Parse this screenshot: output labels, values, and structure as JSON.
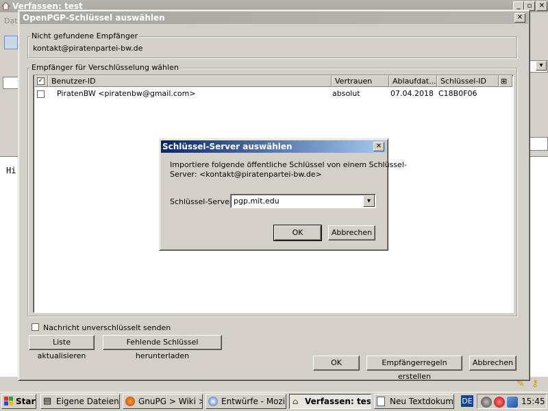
{
  "background_window": {
    "title": "Verfassen: test",
    "menu_partial": "Date",
    "editor_text": "Hi"
  },
  "openpgp_dialog": {
    "title": "OpenPGP-Schlüssel auswählen",
    "not_found_group": {
      "label": "Nicht gefundene Empfänger",
      "email": "kontakt@piratenpartei-bw.de"
    },
    "recipients_group": {
      "label": "Empfänger für Verschlüsselung wählen",
      "columns": [
        "Benutzer-ID",
        "Vertrauen",
        "Ablaufdat...",
        "Schlüssel-ID"
      ],
      "rows": [
        {
          "user_id": "PiratenBW <piratenbw@gmail.com>",
          "trust": "absolut",
          "expiry": "07.04.2018",
          "key_id": "C18B0F06",
          "checked": false
        }
      ]
    },
    "send_unencrypted_label": "Nachricht unverschlüsselt senden",
    "refresh_button": "Liste aktualisieren",
    "download_missing_button": "Fehlende Schlüssel herunterladen",
    "ok_button": "OK",
    "create_rules_button": "Empfängerregeln erstellen",
    "cancel_button": "Abbrechen"
  },
  "keyserver_dialog": {
    "title": "Schlüssel-Server auswählen",
    "message_line1": "Importiere folgende öffentliche Schlüssel von einem Schlüssel-",
    "message_line2": "Server: <kontakt@piratenpartei-bw.de>",
    "server_label": "Schlüssel-Server",
    "server_value": "pgp.mit.edu",
    "ok_button": "OK",
    "cancel_button": "Abbrechen"
  },
  "taskbar": {
    "start_label": "Start",
    "items": [
      {
        "label": "Eigene Dateien",
        "active": false
      },
      {
        "label": "GnuPG > Wiki > u...",
        "active": false
      },
      {
        "label": "Entwürfe - Mozill...",
        "active": false
      },
      {
        "label": "Verfassen: test",
        "active": true
      },
      {
        "label": "Neu Textdokum...",
        "active": false
      }
    ],
    "language": "DE",
    "clock": "15:45"
  },
  "colors": {
    "active_title_start": "#0a246a",
    "active_title_end": "#a6caf0",
    "face": "#d4d0c8"
  }
}
